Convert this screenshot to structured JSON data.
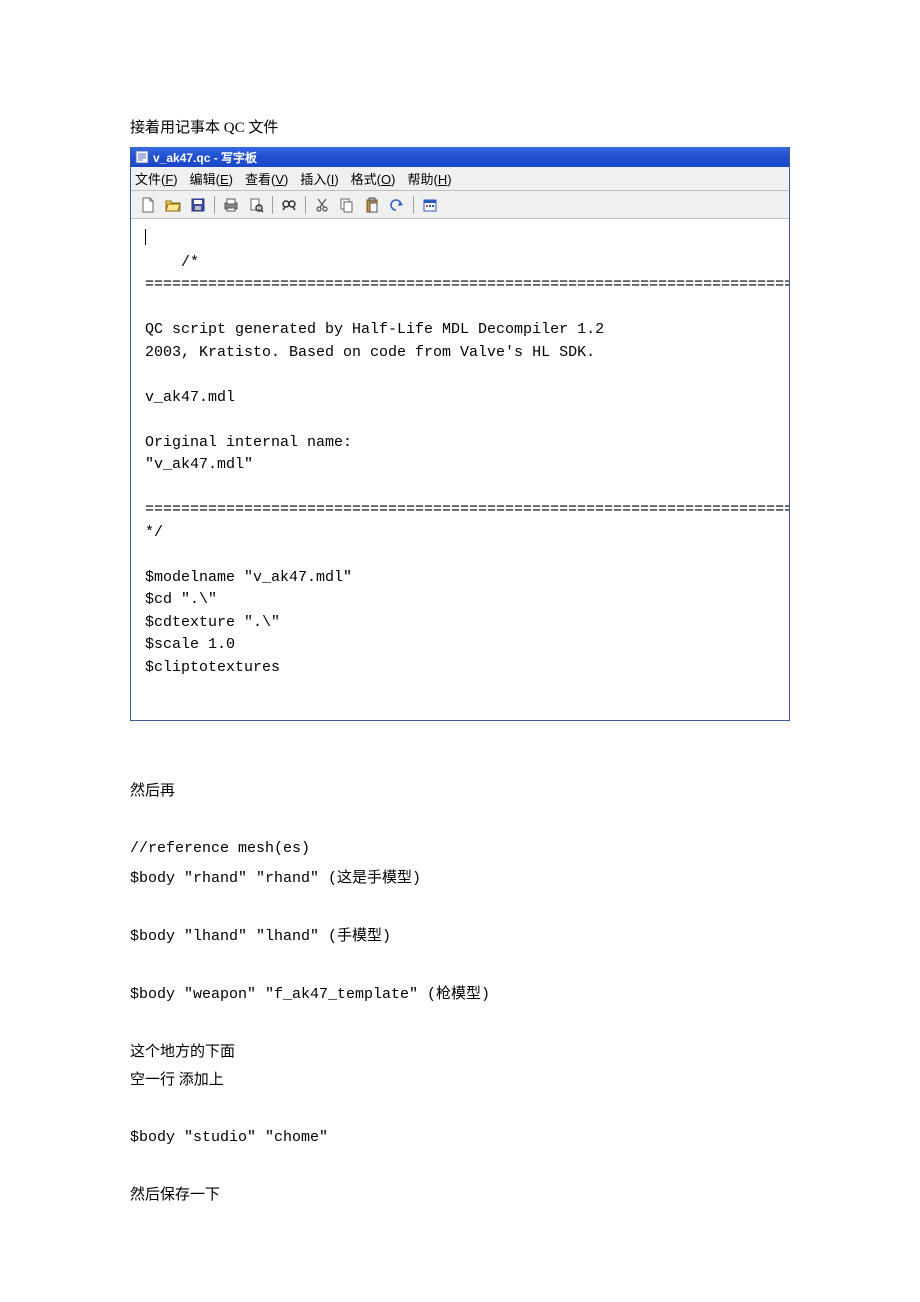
{
  "heading1": "接着用记事本 QC 文件",
  "titlebar": "v_ak47.qc - 写字板",
  "menu": {
    "file": "文件(F)",
    "edit": "编辑(E)",
    "view": "查看(V)",
    "insert": "插入(I)",
    "format": "格式(O)",
    "help": "帮助(H)"
  },
  "editor_content": "/*\n==============================================================================\n\nQC script generated by Half-Life MDL Decompiler 1.2\n2003, Kratisto. Based on code from Valve's HL SDK.\n\nv_ak47.mdl\n\nOriginal internal name:\n\"v_ak47.mdl\"\n\n==============================================================================\n*/\n\n$modelname \"v_ak47.mdl\"\n$cd \".\\\"\n$cdtexture \".\\\"\n$scale 1.0\n$cliptotextures",
  "heading2": "然后再",
  "body_lines": {
    "ref": "//reference mesh(es)",
    "l1": "$body \"rhand\" \"rhand\" (这是手模型)",
    "l2": "$body \"lhand\" \"lhand\" (手模型)",
    "l3": "$body \"weapon\" \"f_ak47_template\" (枪模型)",
    "note1": "这个地方的下面",
    "note2": "空一行 添加上",
    "l4": "$body \"studio\" \"chome\"",
    "note3": "然后保存一下"
  }
}
